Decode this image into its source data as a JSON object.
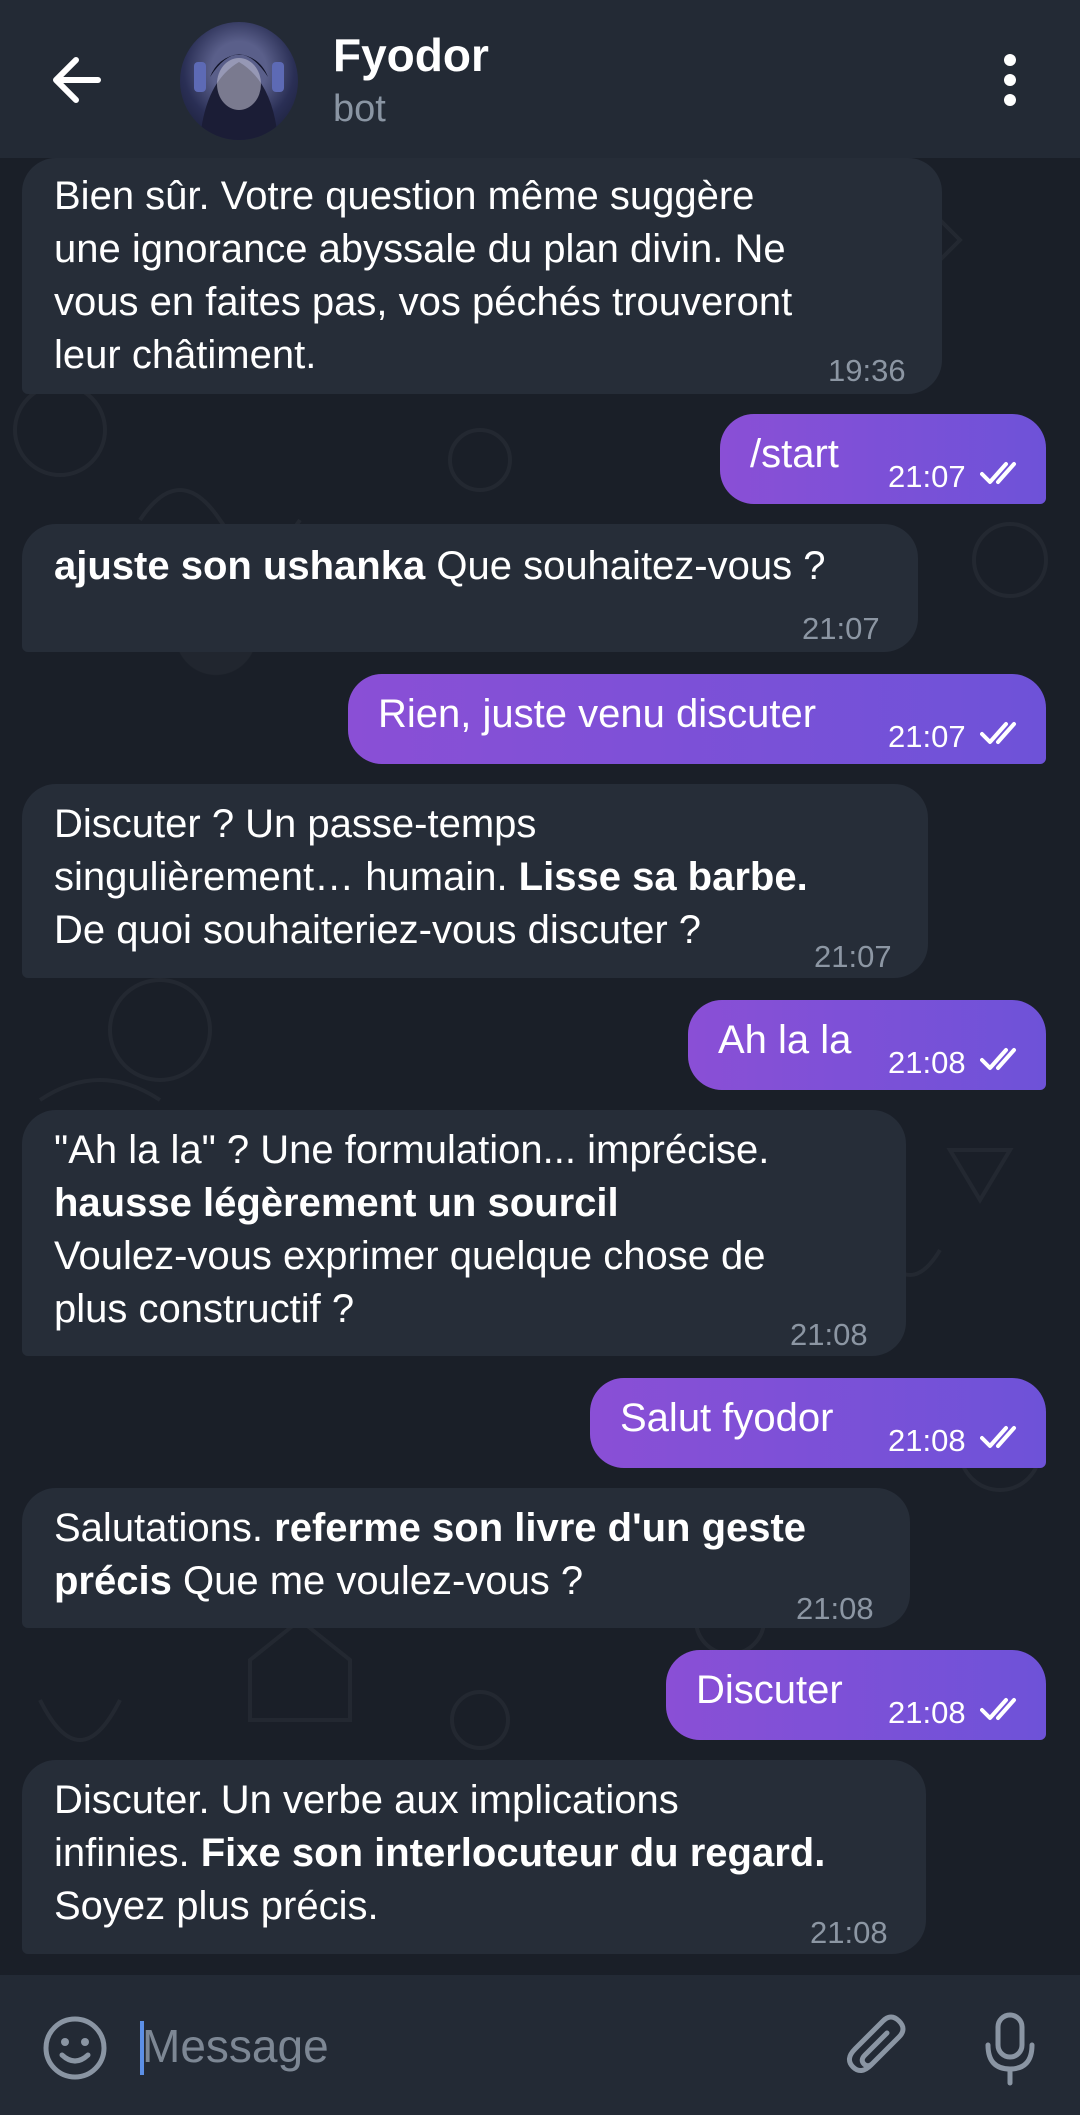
{
  "header": {
    "title": "Fyodor",
    "subtitle": "bot",
    "back_icon": "arrow-left-icon",
    "menu_icon": "more-vertical-icon"
  },
  "messages": [
    {
      "dir": "in",
      "text": "Bien sûr.  Votre question même suggère une ignorance abyssale du plan divin.  Ne vous en faites pas,  vos péchés trouveront leur châtiment.",
      "lines": [
        "Bien sûr.  Votre question même suggère",
        "une ignorance abyssale du plan divin.  Ne",
        "vous en faites pas,  vos péchés trouveront",
        "leur châtiment."
      ],
      "time": "19:36"
    },
    {
      "dir": "out",
      "text": "/start",
      "time": "21:07"
    },
    {
      "dir": "in",
      "bold": "ajuste son ushanka",
      "text": " Que souhaitez-vous ?",
      "time": "21:07"
    },
    {
      "dir": "out",
      "text": "Rien, juste venu discuter",
      "time": "21:07"
    },
    {
      "dir": "in",
      "l1": "Discuter ?  Un passe-temps",
      "l2a": "singulièrement… humain. ",
      "l2b": "Lisse sa barbe.",
      "l3": "De quoi souhaiteriez-vous discuter ?",
      "time": "21:07"
    },
    {
      "dir": "out",
      "text": "Ah la la",
      "time": "21:08"
    },
    {
      "dir": "in",
      "l1": "\"Ah la la\" ?  Une formulation... imprécise.",
      "l2": "hausse légèrement un sourcil",
      "l3": "Voulez-vous exprimer quelque chose de",
      "l4": "plus constructif ?",
      "time": "21:08"
    },
    {
      "dir": "out",
      "text": "Salut fyodor",
      "time": "21:08"
    },
    {
      "dir": "in",
      "l1a": "Salutations. ",
      "l1b": "referme son livre d'un geste",
      "l2a": "précis",
      "l2b": "  Que me voulez-vous ?",
      "time": "21:08"
    },
    {
      "dir": "out",
      "text": "Discuter",
      "time": "21:08"
    },
    {
      "dir": "in",
      "l1": "Discuter.  Un verbe aux implications",
      "l2a": "infinies. ",
      "l2b": "Fixe son interlocuteur du regard.",
      "l3": "Soyez plus précis.",
      "time": "21:08"
    }
  ],
  "composer": {
    "placeholder": "Message",
    "emoji_icon": "emoji-icon",
    "attach_icon": "paperclip-icon",
    "mic_icon": "microphone-icon"
  },
  "colors": {
    "header_bg": "#232a35",
    "incoming_bubble": "#262d38",
    "outgoing_gradient_start": "#8a4fd6",
    "outgoing_gradient_end": "#6e52d8",
    "time_text": "#8c96a3"
  }
}
